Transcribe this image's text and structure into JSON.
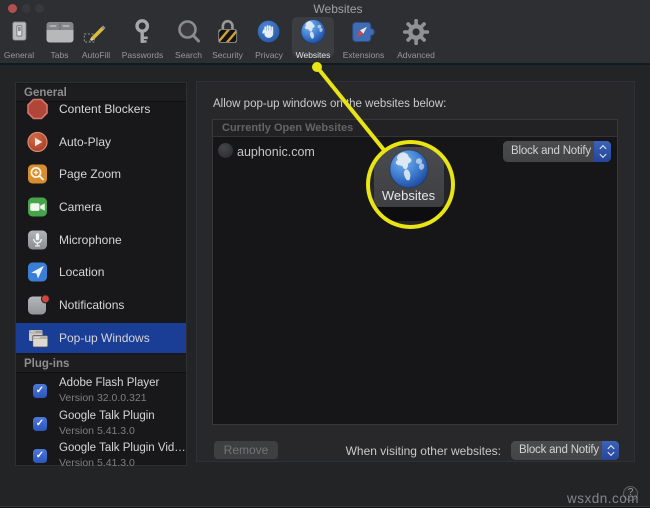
{
  "window": {
    "title": "Websites",
    "traffic_lights": {
      "close": "#b1504e",
      "minimize": "#37383c",
      "zoom": "#37383c"
    }
  },
  "toolbar": {
    "items": [
      {
        "id": "general",
        "label": "General",
        "selected": false
      },
      {
        "id": "tabs",
        "label": "Tabs",
        "selected": false
      },
      {
        "id": "autofill",
        "label": "AutoFill",
        "selected": false
      },
      {
        "id": "passwords",
        "label": "Passwords",
        "selected": false
      },
      {
        "id": "search",
        "label": "Search",
        "selected": false
      },
      {
        "id": "security",
        "label": "Security",
        "selected": false
      },
      {
        "id": "privacy",
        "label": "Privacy",
        "selected": false
      },
      {
        "id": "websites",
        "label": "Websites",
        "selected": true
      },
      {
        "id": "extensions",
        "label": "Extensions",
        "selected": false
      },
      {
        "id": "advanced",
        "label": "Advanced",
        "selected": false
      }
    ]
  },
  "sidebar": {
    "general_header": "General",
    "general_items": [
      {
        "id": "content-blockers",
        "label": "Content Blockers",
        "selected": false
      },
      {
        "id": "auto-play",
        "label": "Auto-Play",
        "selected": false
      },
      {
        "id": "page-zoom",
        "label": "Page Zoom",
        "selected": false
      },
      {
        "id": "camera",
        "label": "Camera",
        "selected": false
      },
      {
        "id": "microphone",
        "label": "Microphone",
        "selected": false
      },
      {
        "id": "location",
        "label": "Location",
        "selected": false
      },
      {
        "id": "notifications",
        "label": "Notifications",
        "selected": false,
        "badge": true
      },
      {
        "id": "popup-windows",
        "label": "Pop-up Windows",
        "selected": true
      }
    ],
    "plugins_header": "Plug-ins",
    "plugin_items": [
      {
        "label": "Adobe Flash Player",
        "version": "Version 32.0.0.321",
        "checked": true
      },
      {
        "label": "Google Talk Plugin",
        "version": "Version 5.41.3.0",
        "checked": true
      },
      {
        "label": "Google Talk Plugin Vid…",
        "version": "Version 5.41.3.0",
        "checked": true
      }
    ]
  },
  "main": {
    "allow_label": "Allow pop-up windows on the websites below:",
    "list_header": "Currently Open Websites",
    "rows": [
      {
        "site": "auphonic.com",
        "policy": "Block and Notify"
      }
    ],
    "remove_label": "Remove",
    "other_label": "When visiting other websites:",
    "other_policy": "Block and Notify"
  },
  "callout": {
    "label": "Websites",
    "highlight_color": "#e9e414"
  },
  "help": {
    "label": "?"
  },
  "watermark": "wsxdn.com"
}
